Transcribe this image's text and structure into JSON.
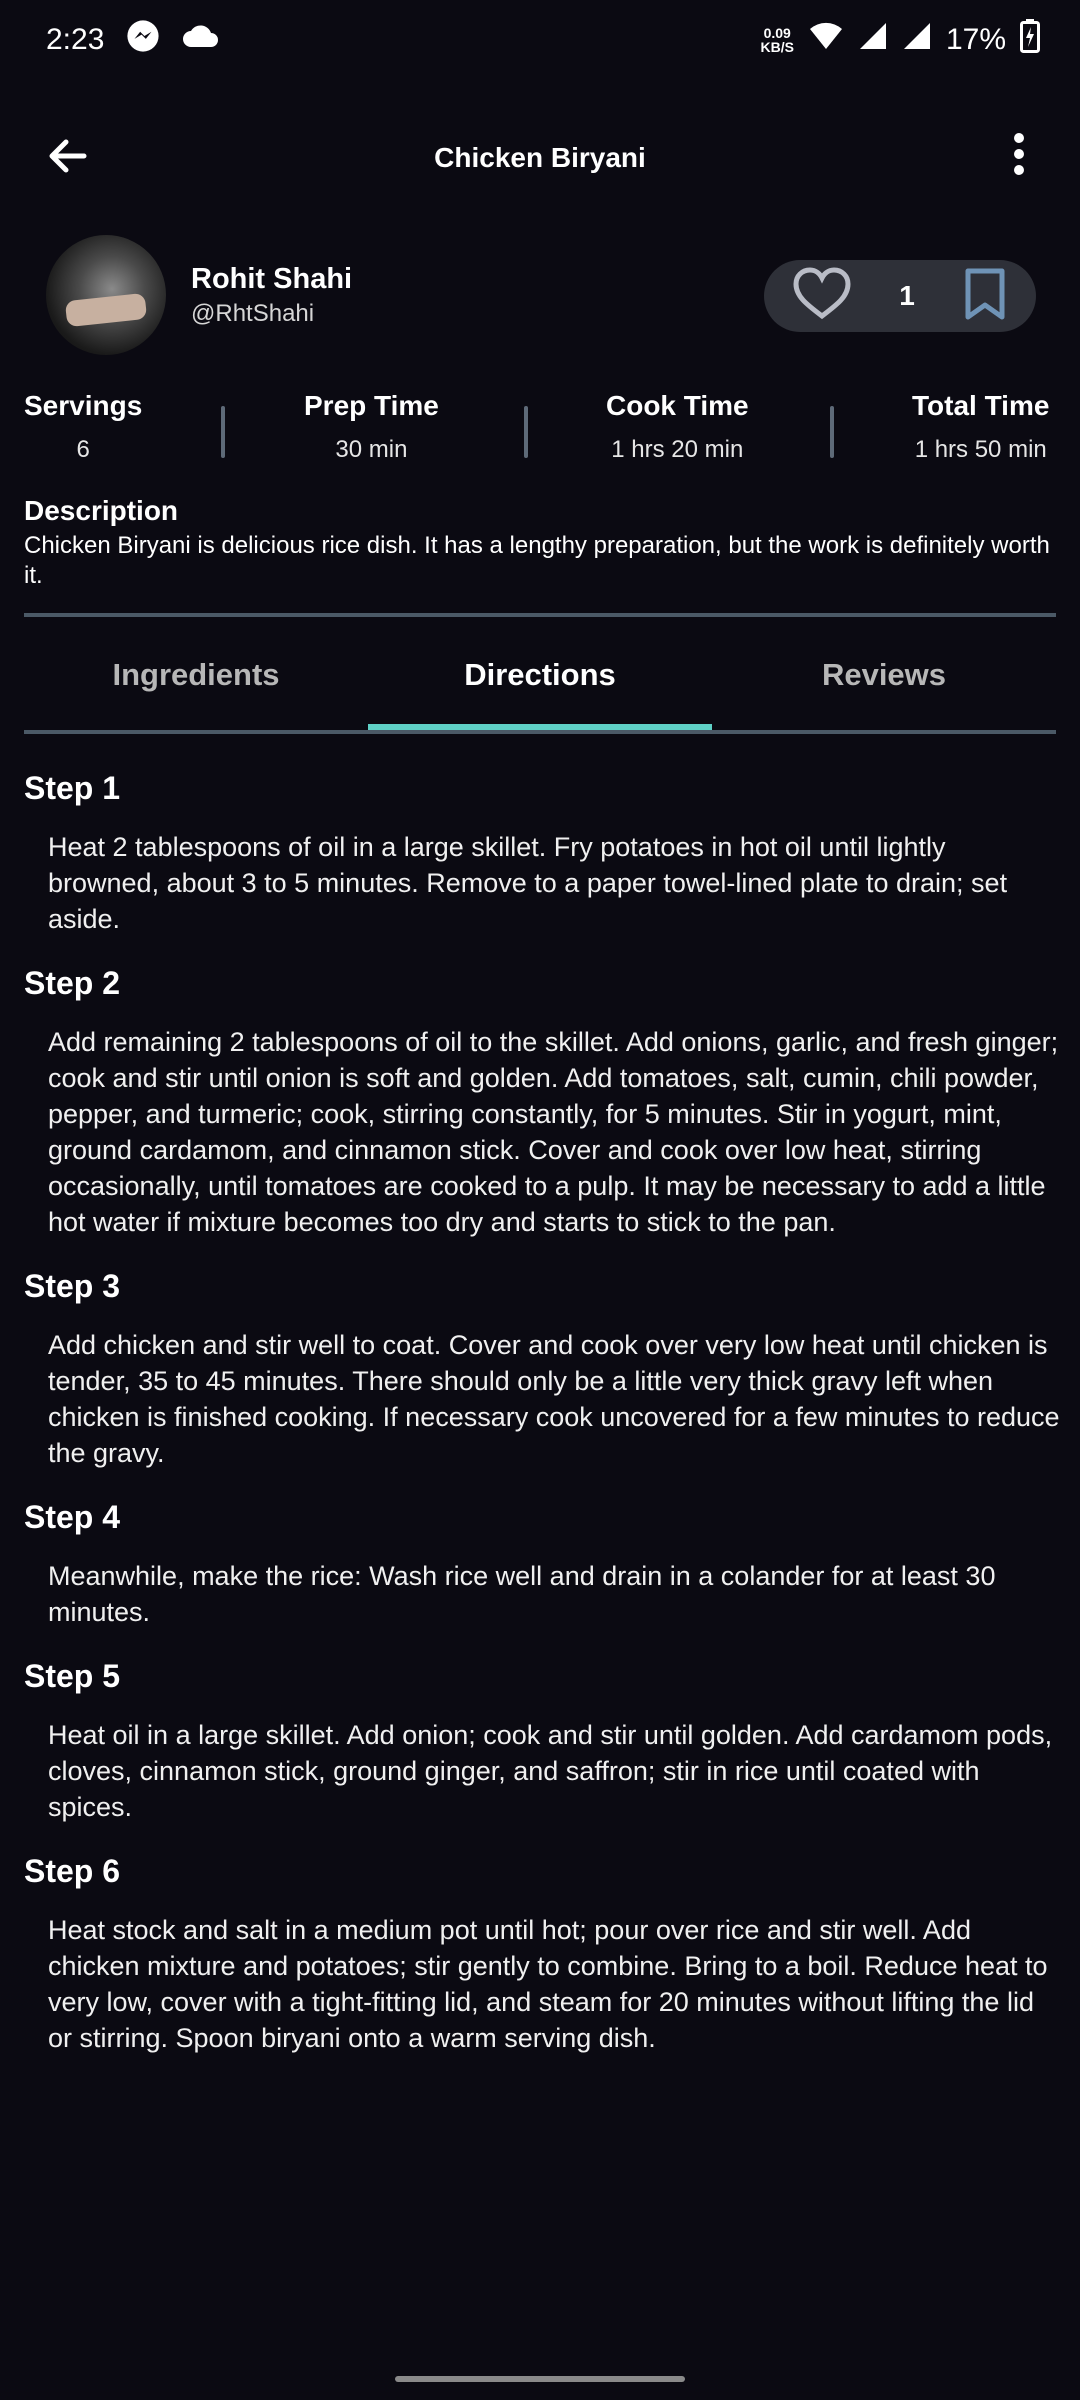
{
  "status_bar": {
    "time": "2:23",
    "net_speed_value": "0.09",
    "net_speed_unit": "KB/S",
    "battery": "17%"
  },
  "toolbar": {
    "title": "Chicken Biryani"
  },
  "author": {
    "name": "Rohit Shahi",
    "handle": "@RhtShahi"
  },
  "actions": {
    "like_count": "1"
  },
  "stats": [
    {
      "label": "Servings",
      "value": "6"
    },
    {
      "label": "Prep Time",
      "value": "30 min"
    },
    {
      "label": "Cook Time",
      "value": "1 hrs 20 min"
    },
    {
      "label": "Total Time",
      "value": "1 hrs 50 min"
    }
  ],
  "description": {
    "heading": "Description",
    "text": "Chicken Biryani is delicious rice dish. It has a lengthy preparation, but the work is definitely worth it."
  },
  "tabs": [
    "Ingredients",
    "Directions",
    "Reviews"
  ],
  "steps": [
    {
      "title": "Step 1",
      "text": "Heat 2 tablespoons of oil in a large skillet. Fry potatoes in hot oil until lightly browned, about 3 to 5 minutes. Remove to a paper towel-lined plate to drain; set aside."
    },
    {
      "title": "Step 2",
      "text": "Add remaining 2 tablespoons of oil to the skillet. Add onions, garlic, and fresh ginger; cook and stir until onion is soft and golden. Add tomatoes, salt, cumin, chili powder, pepper, and turmeric; cook, stirring constantly, for 5 minutes. Stir in yogurt, mint, ground cardamom, and cinnamon stick. Cover and cook over low heat, stirring occasionally, until tomatoes are cooked to a pulp. It may be necessary to add a little hot water if mixture becomes too dry and starts to stick to the pan."
    },
    {
      "title": "Step 3",
      "text": "Add chicken and stir well to coat. Cover and cook over very low heat until chicken is tender, 35 to 45 minutes. There should only be a little very thick gravy left when chicken is finished cooking. If necessary cook uncovered for a few minutes to reduce the gravy."
    },
    {
      "title": "Step 4",
      "text": "Meanwhile, make the rice: Wash rice well and drain in a colander for at least 30 minutes."
    },
    {
      "title": "Step 5",
      "text": "Heat oil in a large skillet. Add onion; cook and stir until golden. Add cardamom pods, cloves, cinnamon stick, ground ginger, and saffron; stir in rice until coated with spices."
    },
    {
      "title": "Step 6",
      "text": "Heat stock and salt in a medium pot until hot; pour over rice and stir well. Add chicken mixture and potatoes; stir gently to combine. Bring to a boil. Reduce heat to very low, cover with a tight-fitting lid, and steam for 20 minutes without lifting the lid or stirring. Spoon biryani onto a warm serving dish."
    }
  ],
  "colors": {
    "background": "#0b0a12",
    "accent": "#5fd1c6",
    "pill": "#2e3038"
  }
}
